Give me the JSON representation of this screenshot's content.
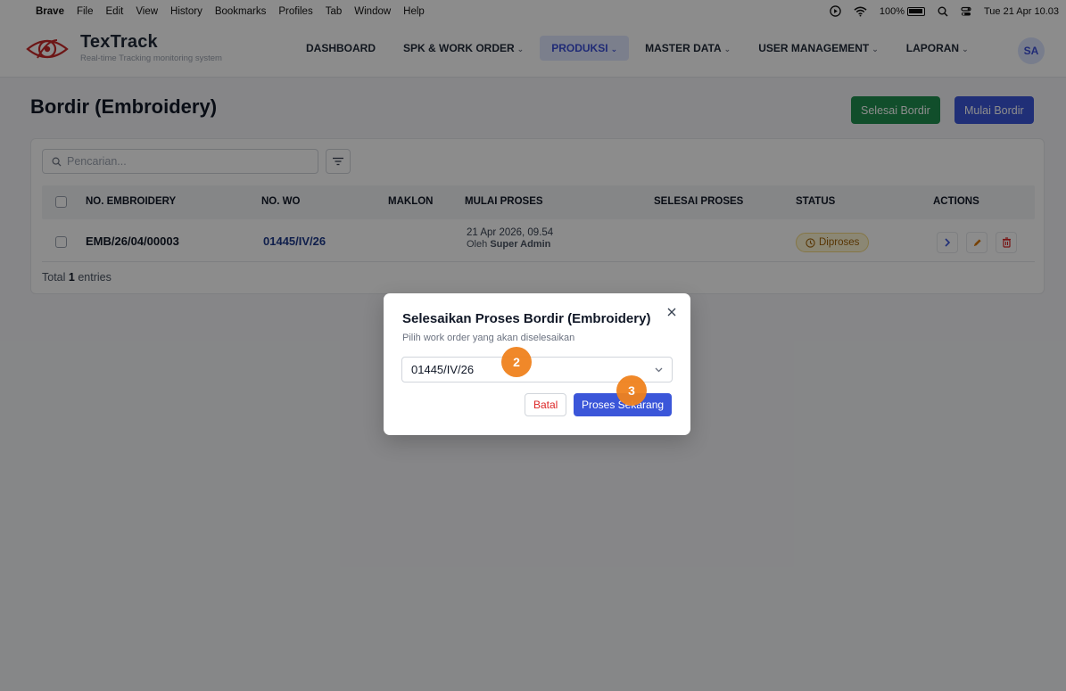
{
  "menubar": {
    "app": "Brave",
    "items": [
      "File",
      "Edit",
      "View",
      "History",
      "Bookmarks",
      "Profiles",
      "Tab",
      "Window",
      "Help"
    ],
    "battery": "100%",
    "datetime": "Tue 21 Apr 10.03"
  },
  "app": {
    "name": "TexTrack",
    "tagline": "Real-time Tracking monitoring system",
    "nav": [
      {
        "label": "DASHBOARD",
        "caret": ""
      },
      {
        "label": "SPK & WORK ORDER",
        "caret": "⌄"
      },
      {
        "label": "PRODUKSI",
        "caret": "⌄"
      },
      {
        "label": "MASTER DATA",
        "caret": "⌄"
      },
      {
        "label": "USER MANAGEMENT",
        "caret": "⌄"
      },
      {
        "label": "LAPORAN",
        "caret": "⌄"
      }
    ],
    "active_nav": "PRODUKSI",
    "avatar": "SA"
  },
  "page": {
    "title": "Bordir (Embroidery)",
    "btn_selesai": "Selesai Bordir",
    "btn_mulai": "Mulai Bordir",
    "search_placeholder": "Pencarian...",
    "columns": [
      "NO. EMBROIDERY",
      "NO. WO",
      "MAKLON",
      "MULAI PROSES",
      "SELESAI PROSES",
      "STATUS",
      "ACTIONS"
    ],
    "rows": [
      {
        "no_embroidery": "EMB/26/04/00003",
        "no_wo": "01445/IV/26",
        "maklon": "",
        "mulai_datetime": "21 Apr 2026, 09.54",
        "mulai_by_prefix": "Oleh",
        "mulai_by": "Super Admin",
        "selesai": "",
        "status": "Diproses"
      }
    ],
    "total_prefix": "Total",
    "total_count": "1",
    "total_suffix": "entries"
  },
  "modal": {
    "title": "Selesaikan Proses Bordir (Embroidery)",
    "subtitle": "Pilih work order yang akan diselesaikan",
    "selected_wo": "01445/IV/26",
    "cancel": "Batal",
    "confirm": "Proses Sekarang"
  },
  "annotations": {
    "step2": "2",
    "step3": "3"
  },
  "colors": {
    "primary": "#3b56d9",
    "success": "#1f8f4f",
    "danger": "#dc2626",
    "step": "#f0821e"
  }
}
